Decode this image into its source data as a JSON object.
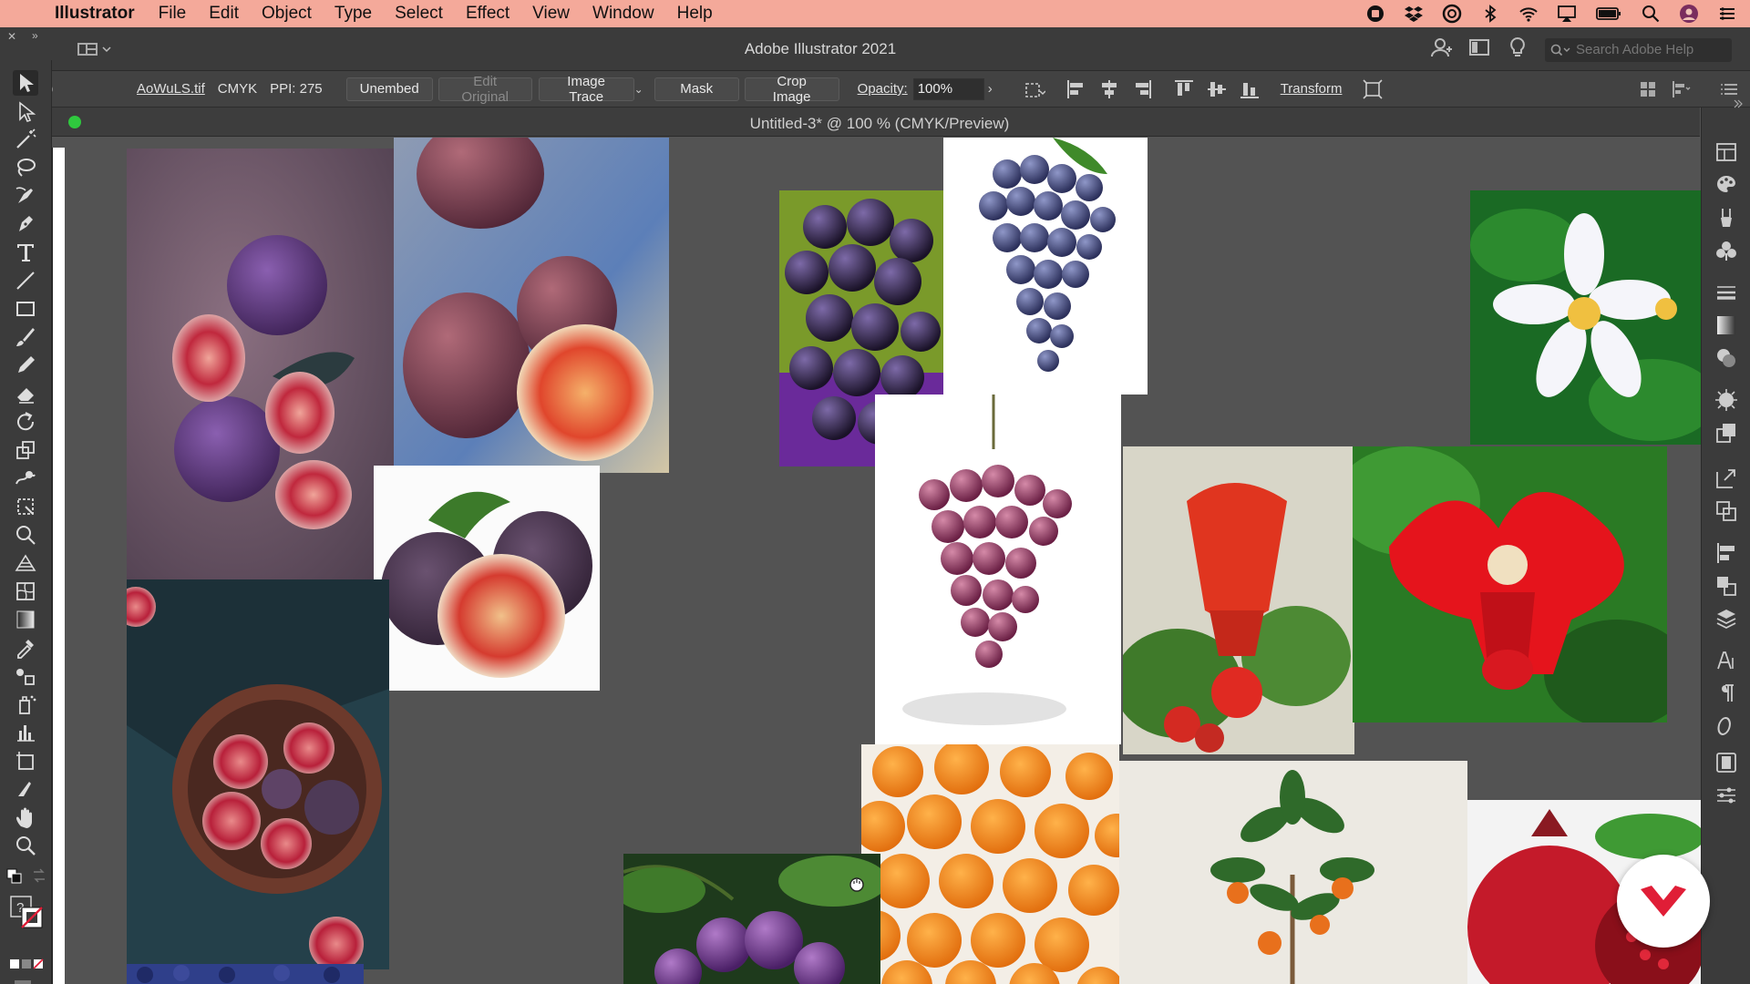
{
  "menubar": {
    "app_name": "Illustrator",
    "items": [
      "File",
      "Edit",
      "Object",
      "Type",
      "Select",
      "Effect",
      "View",
      "Window",
      "Help"
    ],
    "status_icons": [
      "record-icon",
      "dropbox-icon",
      "creative-cloud-icon",
      "bluetooth-icon",
      "wifi-icon",
      "airplay-icon",
      "battery-icon",
      "spotlight-icon",
      "user-avatar-icon",
      "control-center-icon"
    ]
  },
  "appbar": {
    "title": "Adobe Illustrator 2021",
    "search_placeholder": "Search Adobe Help"
  },
  "controlbar": {
    "filename": "AoWuLS.tif",
    "colormode": "CMYK",
    "ppi": "PPI: 275",
    "unembed": "Unembed",
    "edit_original": "Edit Original",
    "image_trace": "Image Trace",
    "mask": "Mask",
    "crop_image": "Crop Image",
    "opacity_label": "Opacity:",
    "opacity_value": "100%",
    "transform": "Transform"
  },
  "document": {
    "title": "Untitled-3* @ 100 % (CMYK/Preview)"
  },
  "colors": {
    "menubar_bg": "#f4a99a",
    "canvas_bg": "#535353",
    "panel_bg": "#3b3b3b",
    "accent_red": "#e01e37"
  }
}
